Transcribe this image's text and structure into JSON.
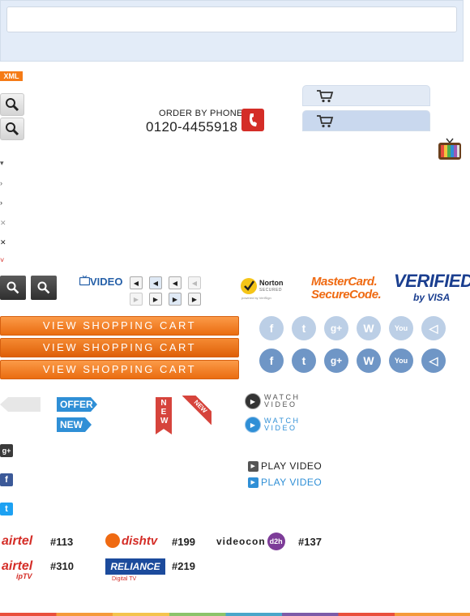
{
  "header": {
    "xml_badge": "XML"
  },
  "order": {
    "label": "ORDER BY PHONE",
    "phone": "0120-4455918"
  },
  "video": {
    "label": "VIDEO"
  },
  "trust": {
    "mastercard_line1": "MasterCard.",
    "mastercard_line2": "SecureCode.",
    "visa_line1": "VERIFIED",
    "visa_line2": "by VISA",
    "norton_line1": "Norton",
    "norton_line2": "SECURED",
    "norton_line3": "powered by VeriSign"
  },
  "cart_buttons": [
    "VIEW SHOPPING CART",
    "VIEW SHOPPING CART",
    "VIEW SHOPPING CART"
  ],
  "tags": {
    "offer": "OFFER",
    "new": "NEW",
    "ribbon": "NEW",
    "corner": "NEW"
  },
  "watch_video": {
    "line1": "WATCH",
    "line2": "VIDEO"
  },
  "play_video": "PLAY VIDEO",
  "operators": {
    "airtel": "airtel",
    "dishtv": "dishtv",
    "videocon": "videocon",
    "d2h": "d2h",
    "airtel_iptv": "airtel",
    "iptv": "ipTV",
    "reliance": "RELIANCE",
    "reliance_sub": "Digital TV"
  },
  "channels": {
    "airtel": "#113",
    "dishtv": "#199",
    "videocon": "#137",
    "airtel_iptv": "#310",
    "reliance": "#219"
  },
  "colors": {
    "orange": "#ef7218",
    "blue": "#2f8fd6",
    "red": "#d42d27"
  }
}
